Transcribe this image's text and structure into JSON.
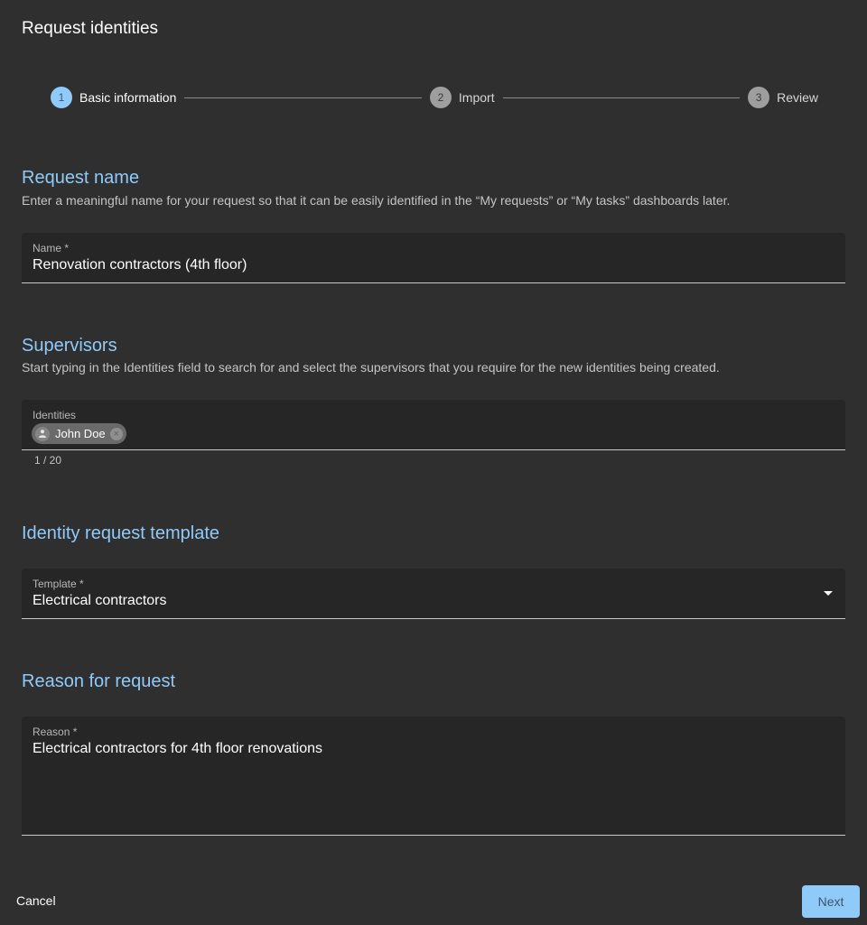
{
  "dialog": {
    "title": "Request identities"
  },
  "stepper": {
    "steps": [
      {
        "number": "1",
        "label": "Basic information",
        "state": "active"
      },
      {
        "number": "2",
        "label": "Import",
        "state": "inactive"
      },
      {
        "number": "3",
        "label": "Review",
        "state": "inactive"
      }
    ]
  },
  "sections": {
    "request_name": {
      "title": "Request name",
      "description": "Enter a meaningful name for your request so that it can be easily identified in the “My requests” or “My tasks” dashboards later.",
      "field": {
        "label": "Name *",
        "value": "Renovation contractors (4th floor)"
      }
    },
    "supervisors": {
      "title": "Supervisors",
      "description": "Start typing in the Identities field to search for and select the supervisors that you require for the new identities being created.",
      "field": {
        "label": "Identities",
        "chips": [
          {
            "label": "John Doe",
            "icon": "person-icon"
          }
        ],
        "counter": "1 / 20"
      }
    },
    "template": {
      "title": "Identity request template",
      "field": {
        "label": "Template *",
        "value": "Electrical contractors",
        "icon": "dropdown-arrow-icon"
      }
    },
    "reason": {
      "title": "Reason for request",
      "field": {
        "label": "Reason *",
        "value": "Electrical contractors for 4th floor renovations"
      }
    }
  },
  "actions": {
    "cancel_label": "Cancel",
    "next_label": "Next"
  },
  "colors": {
    "accent": "#90caf9",
    "background": "#2f2f2f",
    "field_bg": "#262626"
  }
}
